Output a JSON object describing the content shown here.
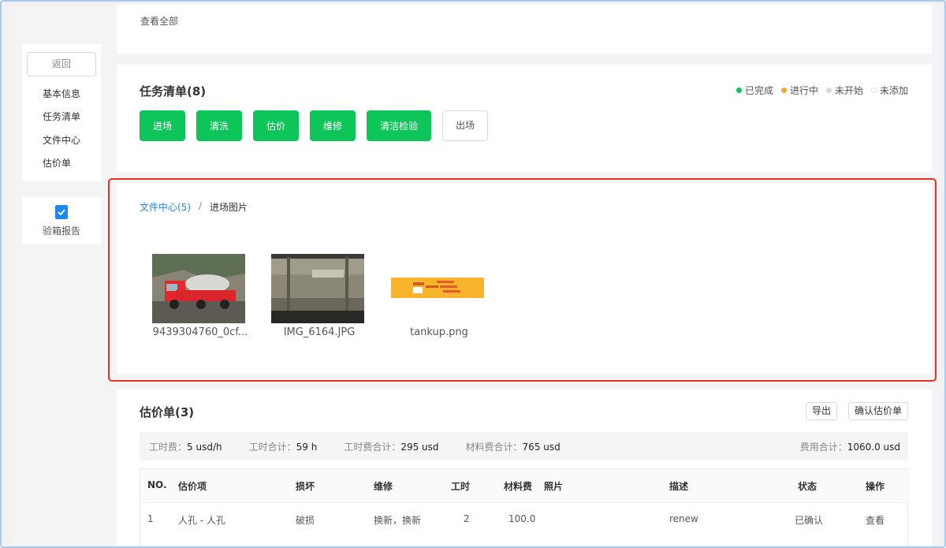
{
  "top": {
    "view_all": "查看全部"
  },
  "sidebar": {
    "back": "返回",
    "items": [
      {
        "label": "基本信息"
      },
      {
        "label": "任务清单"
      },
      {
        "label": "文件中心"
      },
      {
        "label": "估价单"
      }
    ],
    "report": {
      "icon": "doc-check-icon",
      "label": "验箱报告"
    }
  },
  "tasks": {
    "title": "任务清单(8)",
    "legend": [
      {
        "label": "已完成",
        "color": "#0ec55a"
      },
      {
        "label": "进行中",
        "color": "#f5a623"
      },
      {
        "label": "未开始",
        "color": "#d9d9d9"
      },
      {
        "label": "未添加",
        "color": "#ffffff"
      }
    ],
    "buttons": [
      {
        "label": "进场",
        "status": "done"
      },
      {
        "label": "清洗",
        "status": "done"
      },
      {
        "label": "估价",
        "status": "done"
      },
      {
        "label": "维修",
        "status": "done"
      },
      {
        "label": "清洁检验",
        "status": "done"
      },
      {
        "label": "出场",
        "status": "todo"
      }
    ],
    "colors": {
      "done": "#0ec55a"
    }
  },
  "files": {
    "breadcrumb": {
      "root": "文件中心(5)",
      "separator": "/",
      "current": "进场图片"
    },
    "items": [
      {
        "name": "9439304760_0cf...",
        "icon": "red-tanker-truck-photo"
      },
      {
        "name": "IMG_6164.JPG",
        "icon": "tank-container-photo"
      },
      {
        "name": "tankup.png",
        "icon": "orange-banner-image"
      }
    ]
  },
  "estimate": {
    "title": "估价单(3)",
    "export": "导出",
    "confirm": "确认估价单",
    "summary": {
      "labor_rate_label": "工时费：",
      "labor_rate": "5 usd/h",
      "hours_total_label": "工时合计：",
      "hours_total": "59 h",
      "labor_cost_label": "工时费合计：",
      "labor_cost": "295 usd",
      "material_label": "材料费合计：",
      "material": "765 usd",
      "total_label": "费用合计：",
      "total": "1060.0 usd"
    },
    "columns": [
      "NO.",
      "估价项",
      "损坏",
      "维修",
      "工时",
      "材料费",
      "照片",
      "描述",
      "状态",
      "操作"
    ],
    "rows": [
      {
        "no": "1",
        "item": "人孔 - 人孔",
        "damage": "破损",
        "repair": "换新，换新",
        "hours": "2",
        "material": "100.0",
        "photo": "",
        "desc": "renew",
        "status": "已确认",
        "action": "查看"
      }
    ]
  },
  "highlight_color": "#e8302a"
}
